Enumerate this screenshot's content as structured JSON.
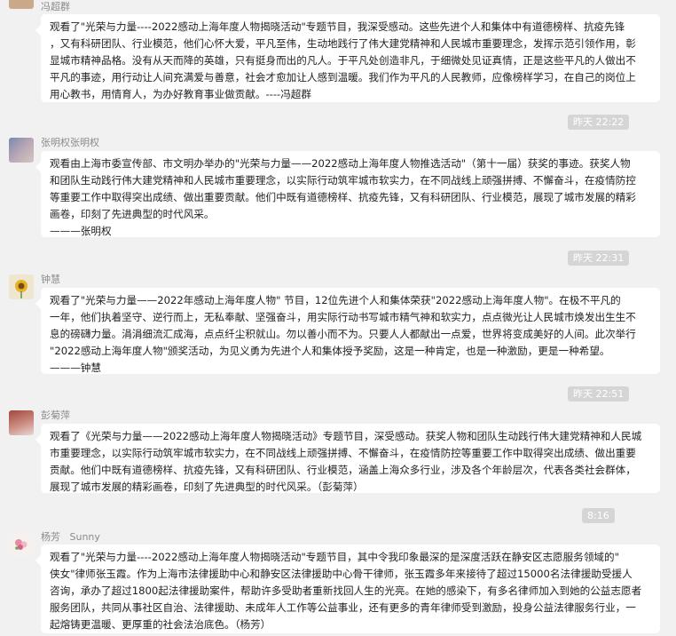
{
  "messages": [
    {
      "sender": "冯超群",
      "lines": [
        "观看了\"光荣与力量----2022感动上海年度人物揭晓活动\"专题节目，我深受感动。这些先进个人和集体中有道德榜样、抗疫先锋",
        "，又有科研团队、行业模范，他们心怀大爱，平凡至伟，生动地践行了伟大建党精神和人民城市重要理念，发挥示范引领作用，彰",
        "显城市精神品格。没有从天而降的英雄，只有挺身而出的凡人。于平凡处创造非凡，于细微处见证真情，正是这些平凡的人做出不",
        "平凡的事迹，用行动让人间充满爱与善意，社会才愈加让人感到温暖。我们作为平凡的人民教师，应像榜样学习，在自己的岗位上",
        "用心教书，用情育人，为办好教育事业做贡献。----冯超群"
      ]
    },
    {
      "time": "昨天 22:22",
      "sender": "张明权张明权",
      "lines": [
        "观看由上海市委宣传部、市文明办举办的\"光荣与力量——2022感动上海年度人物推选活动\"（第十一届）获奖的事迹。获奖人物",
        "和团队生动践行伟大建党精神和人民城市重要理念，以实际行动筑牢城市软实力，在不同战线上顽强拼搏、不懈奋斗，在疫情防控",
        "等重要工作中取得突出成绩、做出重要贡献。他们中既有道德榜样、抗疫先锋，又有科研团队、行业模范，展现了城市发展的精彩",
        "画卷，印刻了先进典型的时代风采。",
        "———张明权"
      ]
    },
    {
      "time": "昨天 22:31",
      "sender": "钟慧",
      "lines": [
        "观看了\"光荣与力量——2022年感动上海年度人物\" 节目，12位先进个人和集体荣获\"2022感动上海年度人物\"。在极不平凡的",
        "一年，他们执着坚守、逆行而上，无私奉献、坚强奋斗，用实际行动书写城市精气神和软实力，点点微光让人民城市焕发出生生不",
        "息的磅礴力量。涓涓细流汇成海，点点纤尘积就山。勿以善小而不为。只要人人都献出一点爱，世界将变成美好的人间。此次举行",
        "\"2022感动上海年度人物\"颁奖活动，为见义勇为先进个人和集体授予奖励，这是一种肯定，也是一种激励，更是一种希望。",
        "———钟慧"
      ]
    },
    {
      "time": "昨天 22:51",
      "sender": "彭菊萍",
      "lines": [
        "观看了《光荣与力量——2022感动上海年度人物揭晓活动》专题节目，深受感动。获奖人物和团队生动践行伟大建党精神和人民城",
        "市重要理念，以实际行动筑牢城市软实力，在不同战线上顽强拼搏、不懈奋斗，在疫情防控等重要工作中取得突出成绩、做出重要",
        "贡献。他们中既有道德榜样、抗疫先锋，又有科研团队、行业模范，涵盖上海众多行业，涉及各个年龄层次，代表各类社会群体，",
        "展现了城市发展的精彩画卷，印刻了先进典型的时代风采。（彭菊萍）"
      ]
    },
    {
      "time": "8:16",
      "sender": "杨芳",
      "sender_sub": "Sunny",
      "lines": [
        "观看了\"光荣与力量----2022感动上海年度人物揭晓活动\"专题节目，其中令我印象最深的是深度活跃在静安区志愿服务领域的\"",
        "侠女\"律师张玉霞。作为上海市法律援助中心和静安区法律援助中心骨干律师，张玉霞多年来接待了超过15000名法律援助受援人",
        "咨询，承办了超过1800起法律援助案件，帮助许多受助者重新找回人生的光亮。在她的感染下，有多名律师加入到她的公益志愿者",
        "服务团队，共同从事社区自治、法律援助、未成年人工作等公益事业，还有更多的青年律师受到激励，投身公益法律服务行业，一",
        "起熔铸更温暖、更厚重的社会法治底色。（杨芳）"
      ]
    }
  ]
}
